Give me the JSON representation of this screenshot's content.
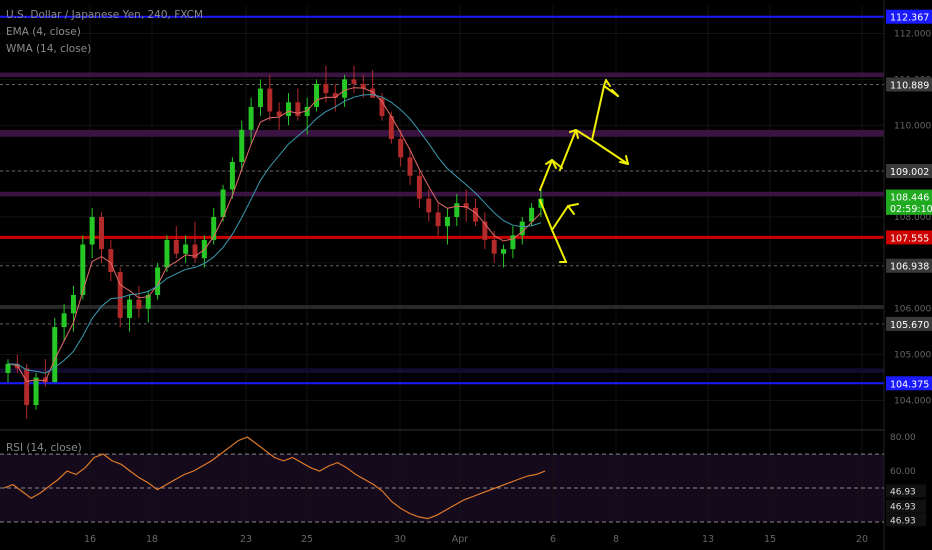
{
  "chart_data": [
    {
      "type": "candlestick",
      "title": "U.S. Dollar / Japanese Yen, 240, FXCM",
      "indicators": [
        "EMA (4, close)",
        "WMA (14, close)"
      ],
      "ylim": [
        103.4,
        112.6
      ],
      "y_ticks": [
        104.0,
        105.0,
        106.0,
        107.0,
        108.0,
        109.0,
        110.0,
        111.0,
        112.0
      ],
      "y_tick_labels": [
        "104.000",
        "105.000",
        "106.000",
        "107.000",
        "108.000",
        "109.000",
        "110.000",
        "111.000",
        "112.000"
      ],
      "x_tick_labels": [
        "16",
        "18",
        "23",
        "25",
        "30",
        "Apr",
        "6",
        "8",
        "13",
        "15",
        "20"
      ],
      "grid": true,
      "price_levels": [
        {
          "label": "112.367",
          "value": 112.367,
          "color": "#1a1aff",
          "style": "line"
        },
        {
          "label": "110.889",
          "value": 110.889,
          "color": "#555555",
          "style": "dashed"
        },
        {
          "label": "109.002",
          "value": 109.002,
          "color": "#555555",
          "style": "dashed"
        },
        {
          "label": "108.446",
          "value": 108.446,
          "color": "#1faa1f",
          "style": "current"
        },
        {
          "label": "02:59:10",
          "value": 108.2,
          "color": "#1faa1f",
          "style": "countdown"
        },
        {
          "label": "107.555",
          "value": 107.555,
          "color": "#cc0000",
          "style": "line"
        },
        {
          "label": "106.938",
          "value": 106.938,
          "color": "#555555",
          "style": "dashed"
        },
        {
          "label": "105.670",
          "value": 105.67,
          "color": "#555555",
          "style": "dashed"
        },
        {
          "label": "104.375",
          "value": 104.375,
          "color": "#1a1aff",
          "style": "line"
        }
      ],
      "zones": [
        {
          "from": 111.05,
          "to": 111.15,
          "color": "#3a1440"
        },
        {
          "from": 109.75,
          "to": 109.9,
          "color": "#3a1440"
        },
        {
          "from": 108.45,
          "to": 108.55,
          "color": "#3a1440"
        },
        {
          "from": 106.0,
          "to": 106.08,
          "color": "#2a2a2a"
        },
        {
          "from": 104.6,
          "to": 104.7,
          "color": "#140b30"
        }
      ],
      "candles_approx": [
        [
          104.6,
          104.9,
          104.4,
          104.8
        ],
        [
          104.8,
          105.0,
          104.6,
          104.7
        ],
        [
          104.7,
          104.8,
          103.6,
          103.9
        ],
        [
          103.9,
          104.6,
          103.8,
          104.5
        ],
        [
          104.5,
          104.9,
          104.3,
          104.4
        ],
        [
          104.4,
          105.8,
          104.4,
          105.6
        ],
        [
          105.6,
          106.1,
          105.3,
          105.9
        ],
        [
          105.9,
          106.5,
          105.5,
          106.3
        ],
        [
          106.3,
          107.6,
          106.2,
          107.4
        ],
        [
          107.4,
          108.2,
          107.1,
          108.0
        ],
        [
          108.0,
          108.1,
          107.0,
          107.3
        ],
        [
          107.3,
          107.5,
          106.6,
          106.8
        ],
        [
          106.8,
          106.9,
          105.6,
          105.8
        ],
        [
          105.8,
          106.3,
          105.5,
          106.2
        ],
        [
          106.2,
          106.5,
          105.8,
          106.0
        ],
        [
          106.0,
          106.4,
          105.7,
          106.3
        ],
        [
          106.3,
          107.0,
          106.2,
          106.9
        ],
        [
          106.9,
          107.6,
          106.8,
          107.5
        ],
        [
          107.5,
          107.8,
          107.1,
          107.2
        ],
        [
          107.2,
          107.6,
          107.0,
          107.4
        ],
        [
          107.4,
          107.9,
          107.0,
          107.1
        ],
        [
          107.1,
          107.6,
          106.9,
          107.5
        ],
        [
          107.5,
          108.2,
          107.4,
          108.0
        ],
        [
          108.0,
          108.7,
          107.9,
          108.6
        ],
        [
          108.6,
          109.3,
          108.4,
          109.2
        ],
        [
          109.2,
          110.1,
          109.0,
          109.9
        ],
        [
          109.9,
          110.6,
          109.6,
          110.4
        ],
        [
          110.4,
          111.0,
          110.2,
          110.8
        ],
        [
          110.8,
          111.1,
          110.1,
          110.3
        ],
        [
          110.3,
          110.5,
          109.9,
          110.2
        ],
        [
          110.2,
          110.7,
          110.0,
          110.5
        ],
        [
          110.5,
          110.8,
          110.1,
          110.2
        ],
        [
          110.2,
          110.6,
          109.8,
          110.4
        ],
        [
          110.4,
          111.0,
          110.3,
          110.9
        ],
        [
          110.9,
          111.3,
          110.5,
          110.7
        ],
        [
          110.7,
          110.9,
          110.3,
          110.6
        ],
        [
          110.6,
          111.1,
          110.4,
          111.0
        ],
        [
          111.0,
          111.3,
          110.7,
          110.9
        ],
        [
          110.9,
          111.1,
          110.6,
          110.8
        ],
        [
          110.8,
          111.2,
          110.6,
          110.6
        ],
        [
          110.6,
          110.7,
          110.1,
          110.2
        ],
        [
          110.2,
          110.3,
          109.6,
          109.7
        ],
        [
          109.7,
          109.9,
          109.1,
          109.3
        ],
        [
          109.3,
          109.5,
          108.7,
          108.9
        ],
        [
          108.9,
          109.0,
          108.2,
          108.4
        ],
        [
          108.4,
          108.6,
          107.9,
          108.1
        ],
        [
          108.1,
          108.3,
          107.6,
          107.8
        ],
        [
          107.8,
          108.2,
          107.4,
          108.0
        ],
        [
          108.0,
          108.5,
          107.8,
          108.3
        ],
        [
          108.3,
          108.6,
          107.9,
          108.2
        ],
        [
          108.2,
          108.4,
          107.8,
          107.9
        ],
        [
          107.9,
          108.1,
          107.3,
          107.5
        ],
        [
          107.5,
          107.7,
          107.0,
          107.2
        ],
        [
          107.2,
          107.4,
          106.9,
          107.3
        ],
        [
          107.3,
          107.8,
          107.1,
          107.6
        ],
        [
          107.6,
          108.0,
          107.4,
          107.9
        ],
        [
          107.9,
          108.3,
          107.8,
          108.2
        ],
        [
          108.2,
          108.6,
          108.0,
          108.4
        ]
      ]
    },
    {
      "type": "line",
      "title": "RSI (14, close)",
      "ylim": [
        30,
        83
      ],
      "y_tick_labels": [
        "80.00",
        "60.00",
        "46.93",
        "46.93",
        "46.93"
      ],
      "guide_levels": [
        70,
        50,
        30
      ],
      "rsi_approx": [
        50,
        52,
        48,
        44,
        47,
        51,
        55,
        60,
        58,
        62,
        68,
        70,
        66,
        64,
        60,
        56,
        53,
        49,
        52,
        55,
        58,
        60,
        63,
        66,
        70,
        74,
        78,
        80,
        76,
        72,
        68,
        66,
        68,
        65,
        62,
        60,
        63,
        65,
        62,
        58,
        55,
        52,
        48,
        42,
        38,
        35,
        33,
        32,
        34,
        37,
        40,
        43,
        45,
        47,
        49,
        51,
        53,
        55,
        57,
        58,
        60
      ]
    }
  ]
}
